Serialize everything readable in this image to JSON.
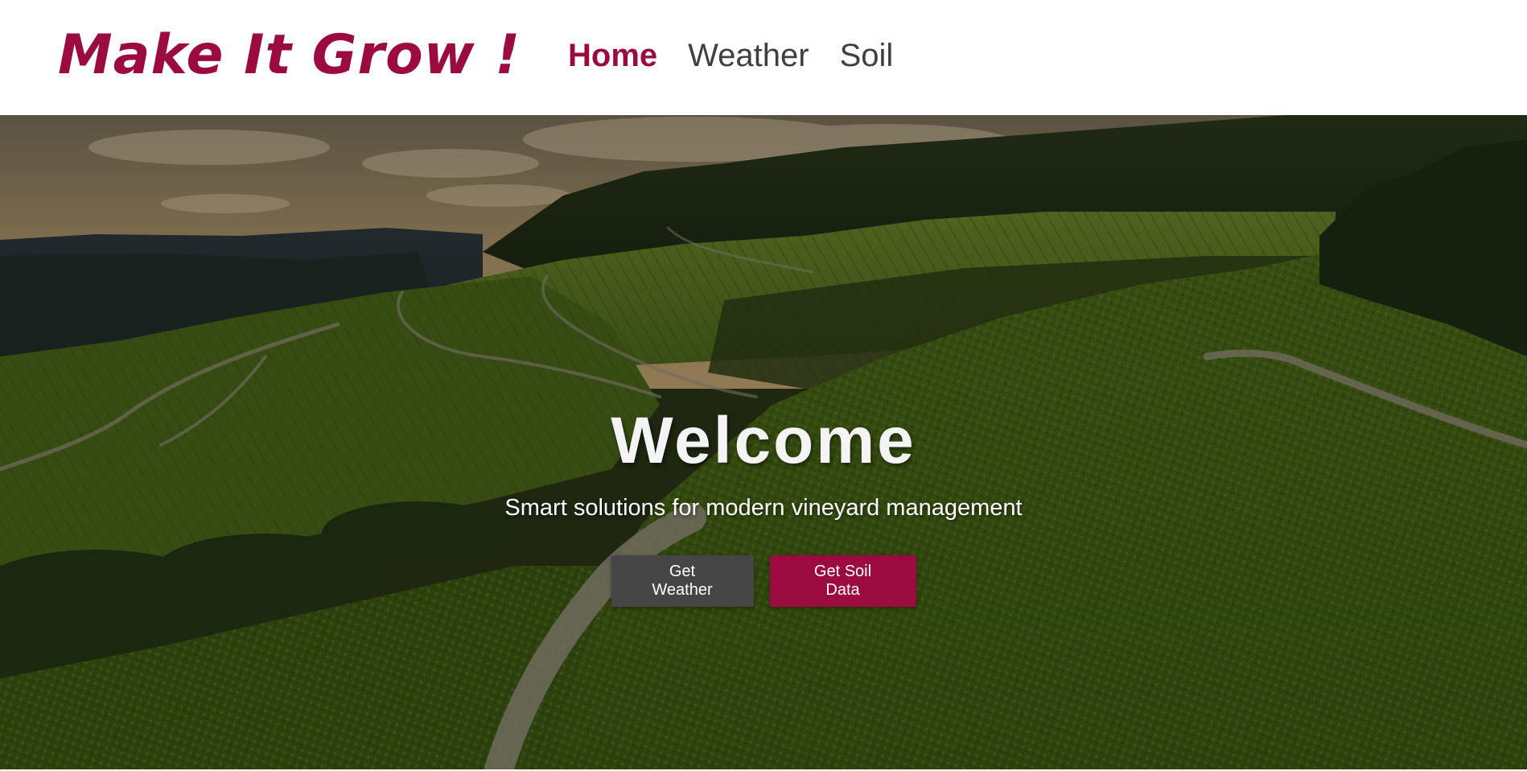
{
  "header": {
    "logo_text": "Make It Grow !",
    "nav": [
      {
        "label": "Home",
        "active": true
      },
      {
        "label": "Weather",
        "active": false
      },
      {
        "label": "Soil",
        "active": false
      }
    ]
  },
  "hero": {
    "title": "Welcome",
    "subtitle": "Smart solutions for modern vineyard management",
    "buttons": {
      "weather_label": "Get Weather",
      "soil_label": "Get Soil Data"
    }
  },
  "colors": {
    "brand": "#9b0b3f",
    "nav_text": "#3f3f3f",
    "secondary_button": "#454545"
  }
}
